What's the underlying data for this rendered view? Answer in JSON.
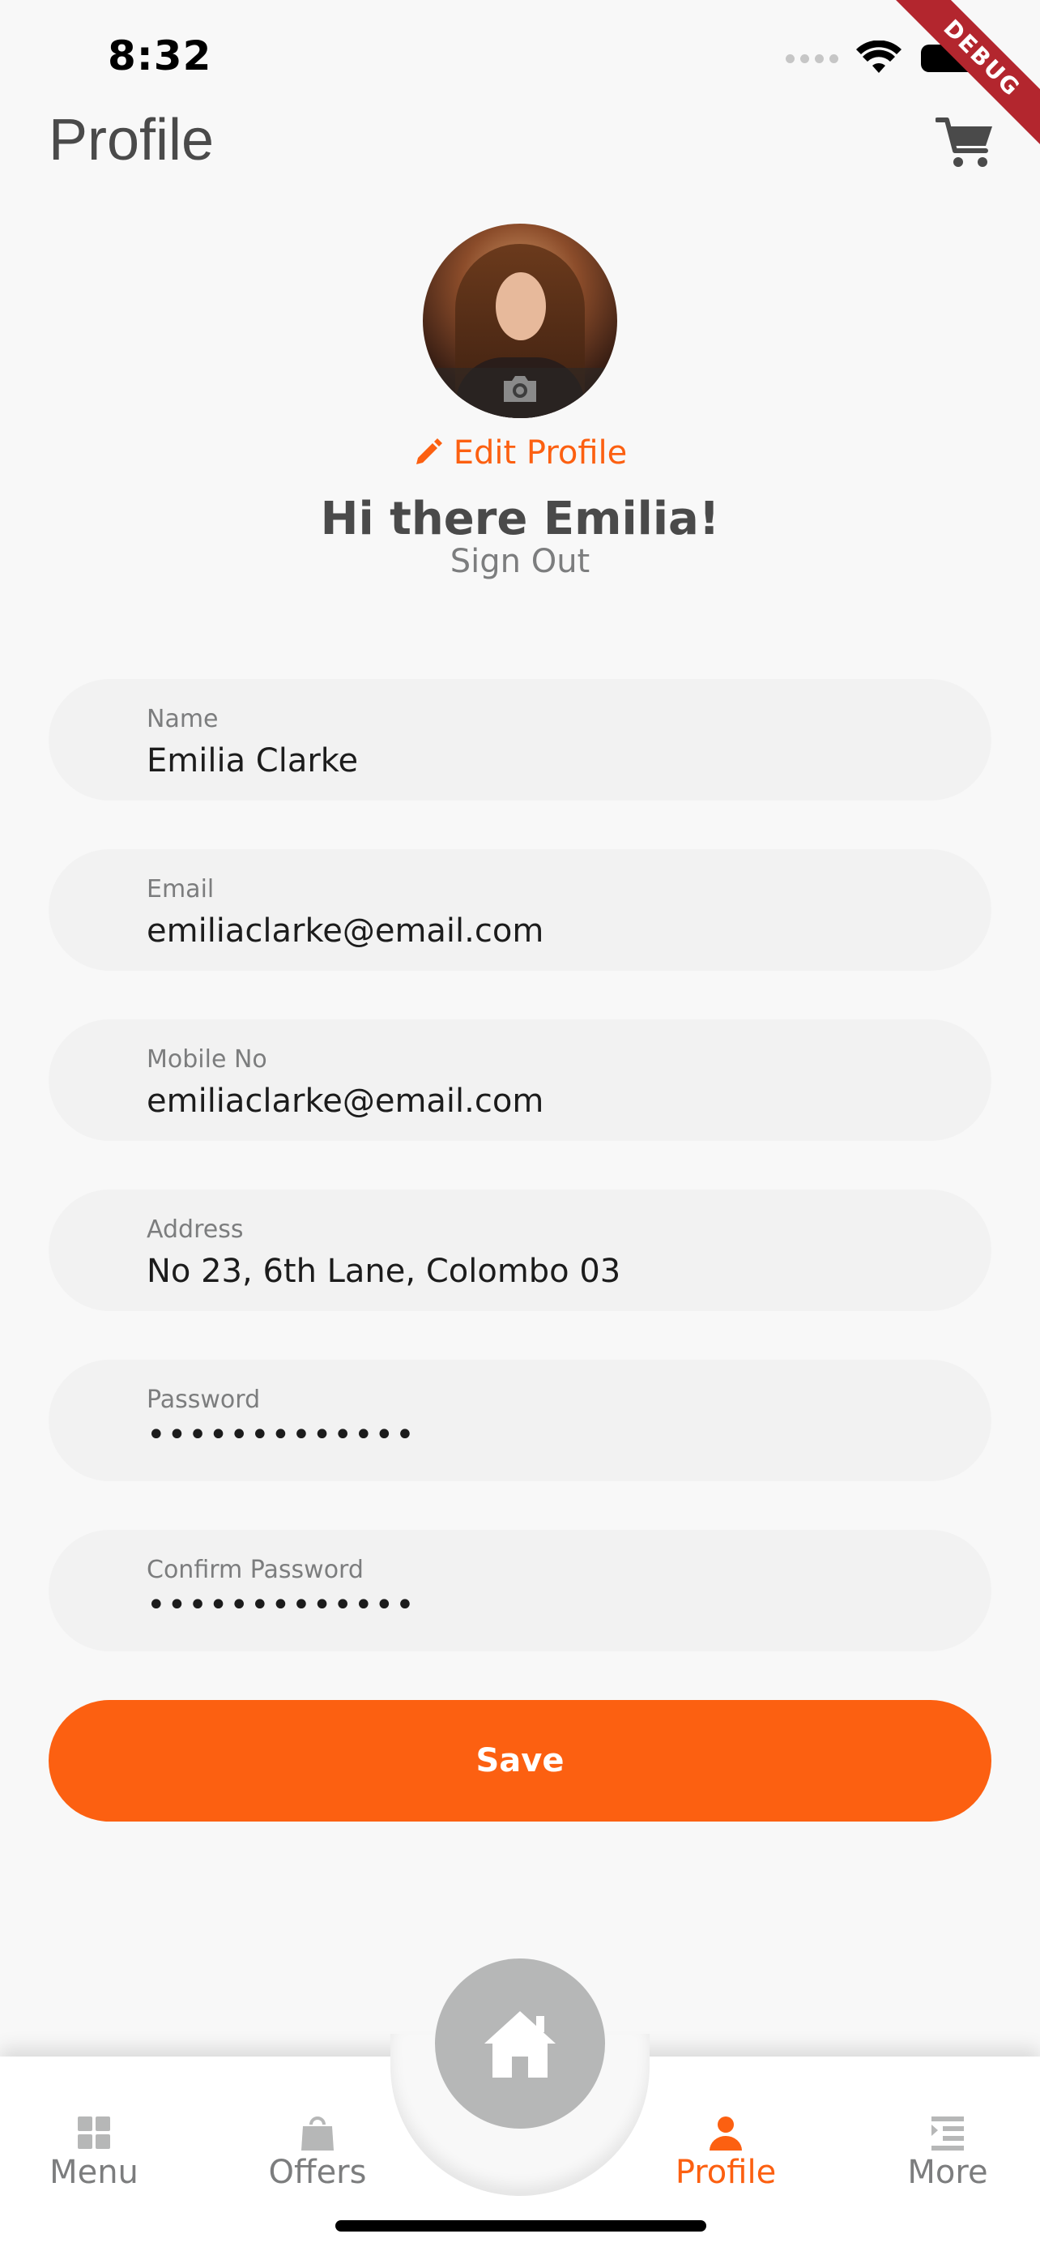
{
  "status_bar": {
    "time": "8:32"
  },
  "debug_ribbon": "DEBUG",
  "header": {
    "title": "Profile"
  },
  "profile": {
    "edit_label": "Edit Profile",
    "greeting": "Hi there Emilia!",
    "sign_out": "Sign Out"
  },
  "form": {
    "fields": [
      {
        "label": "Name",
        "value": "Emilia Clarke"
      },
      {
        "label": "Email",
        "value": "emiliaclarke@email.com"
      },
      {
        "label": "Mobile No",
        "value": "emiliaclarke@email.com"
      },
      {
        "label": "Address",
        "value": "No 23, 6th Lane, Colombo 03"
      },
      {
        "label": "Password",
        "value": "•••••••••••••"
      },
      {
        "label": "Confirm Password",
        "value": "•••••••••••••"
      }
    ],
    "save_label": "Save"
  },
  "bottom_nav": {
    "items": [
      {
        "label": "Menu",
        "icon": "grid-icon",
        "active": false
      },
      {
        "label": "Offers",
        "icon": "shopping-bag-icon",
        "active": false
      },
      {
        "label": "Profile",
        "icon": "person-icon",
        "active": true
      },
      {
        "label": "More",
        "icon": "list-icon",
        "active": false
      }
    ],
    "center_icon": "home-icon"
  },
  "colors": {
    "accent": "#fc6011",
    "primary_text": "#4a4a4a",
    "secondary_text": "#7c7d7e",
    "field_bg": "#f2f2f2",
    "background": "#f8f8f8",
    "inactive_icon": "#b6b7b7"
  }
}
